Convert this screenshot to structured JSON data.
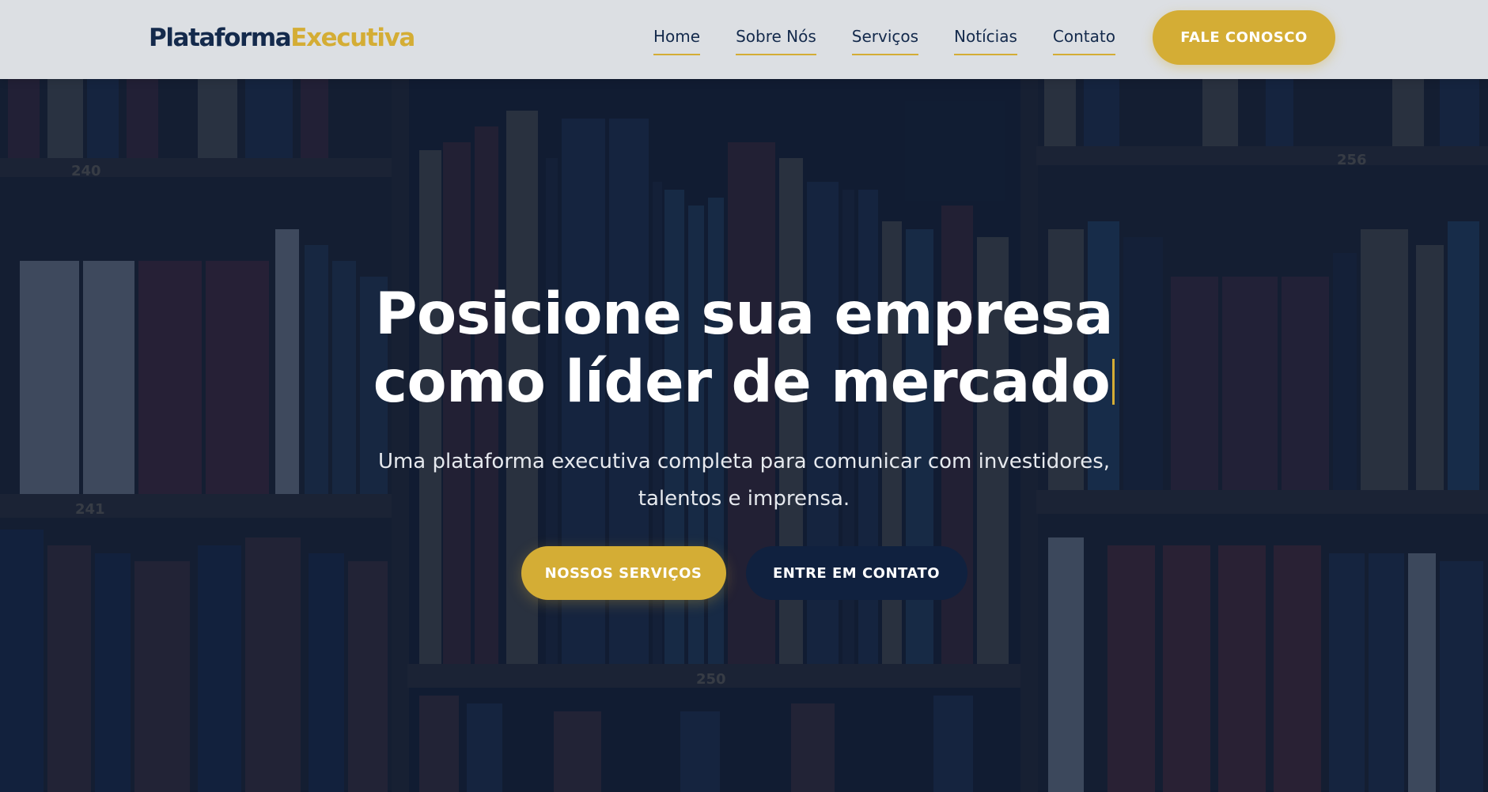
{
  "header": {
    "logo_part1": "Plataforma",
    "logo_part2": "Executiva",
    "nav": [
      {
        "label": "Home"
      },
      {
        "label": "Sobre Nós"
      },
      {
        "label": "Serviços"
      },
      {
        "label": "Notícias"
      },
      {
        "label": "Contato"
      }
    ],
    "cta_label": "FALE CONOSCO"
  },
  "hero": {
    "title_line1": "Posicione sua empresa",
    "title_line2": "como líder de mercado",
    "subtitle": "Uma plataforma executiva completa para comunicar com investidores, talentos e imprensa.",
    "primary_button": "NOSSOS SERVIÇOS",
    "secondary_button": "ENTRE EM CONTATO",
    "shelf_numbers": [
      "240",
      "256",
      "241",
      "250"
    ]
  },
  "colors": {
    "navy": "#142a4c",
    "gold": "#d4ad35",
    "header_bg": "#dcdfe3",
    "overlay": "#0e1e3a"
  }
}
